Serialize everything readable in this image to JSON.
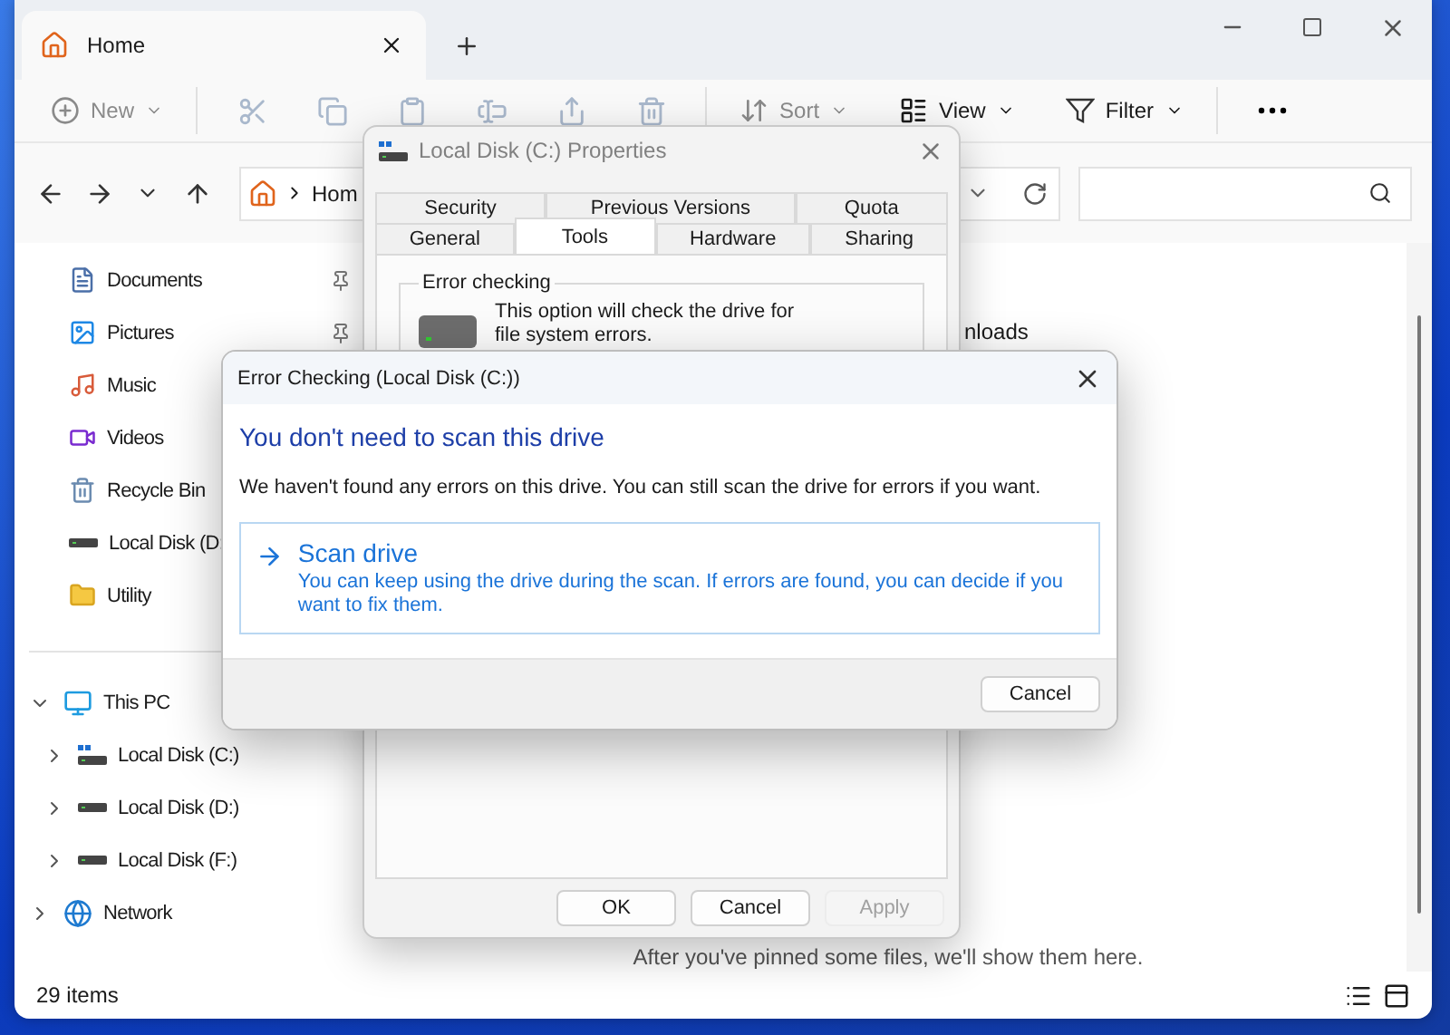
{
  "explorer": {
    "tabs": [
      {
        "label": "Home",
        "selected": true
      }
    ],
    "toolbar": {
      "new": {
        "label": "New",
        "disabled": true
      },
      "clipboard_disabled": true,
      "sort": {
        "label": "Sort",
        "disabled": true
      },
      "view": {
        "label": "View",
        "disabled": false
      },
      "filter": {
        "label": "Filter",
        "disabled": false
      }
    },
    "address": {
      "path": "Hom"
    },
    "quick_access": [
      {
        "label": "Documents",
        "kind": "documents",
        "pinned": true
      },
      {
        "label": "Pictures",
        "kind": "pictures",
        "pinned": true
      },
      {
        "label": "Music",
        "kind": "music"
      },
      {
        "label": "Videos",
        "kind": "videos"
      },
      {
        "label": "Recycle Bin",
        "kind": "recycle"
      },
      {
        "label": "Local Disk (D:",
        "kind": "drive"
      },
      {
        "label": "Utility",
        "kind": "folder"
      }
    ],
    "tree": [
      {
        "label": "This PC",
        "kind": "pc",
        "expanded": true,
        "children": [
          {
            "label": "Local Disk (C:)",
            "kind": "system-drive",
            "expanded": false
          },
          {
            "label": "Local Disk (D:)",
            "kind": "drive",
            "expanded": false
          },
          {
            "label": "Local Disk (F:)",
            "kind": "drive",
            "expanded": false
          }
        ]
      },
      {
        "label": "Network",
        "kind": "network",
        "expanded": false
      }
    ],
    "content": {
      "partial_item": "nloads",
      "empty_message": "After you've pinned some files, we'll show them here."
    },
    "status_bar": {
      "count": "29 items"
    }
  },
  "properties_dialog": {
    "title": "Local Disk (C:) Properties",
    "active": false,
    "tab_rows": [
      [
        {
          "label": "Security",
          "selected": false
        },
        {
          "label": "Previous Versions",
          "selected": false
        },
        {
          "label": "Quota",
          "selected": false
        }
      ],
      [
        {
          "label": "General",
          "selected": false
        },
        {
          "label": "Tools",
          "selected": true
        },
        {
          "label": "Hardware",
          "selected": false
        },
        {
          "label": "Sharing",
          "selected": false
        }
      ]
    ],
    "group": {
      "title": "Error checking",
      "description": "This option will check the drive for file system errors."
    },
    "buttons": [
      {
        "label": "OK",
        "disabled": false
      },
      {
        "label": "Cancel",
        "disabled": false
      },
      {
        "label": "Apply",
        "disabled": true
      }
    ]
  },
  "error_dialog": {
    "title": "Error Checking (Local Disk (C:))",
    "heading": "You don't need to scan this drive",
    "message": "We haven't found any errors on this drive. You can still scan the drive for errors if you want.",
    "option": {
      "title": "Scan drive",
      "description": "You can keep using the drive during the scan. If errors are found, you can decide if you want to fix them."
    },
    "buttons": [
      {
        "label": "Cancel",
        "disabled": false
      }
    ]
  }
}
